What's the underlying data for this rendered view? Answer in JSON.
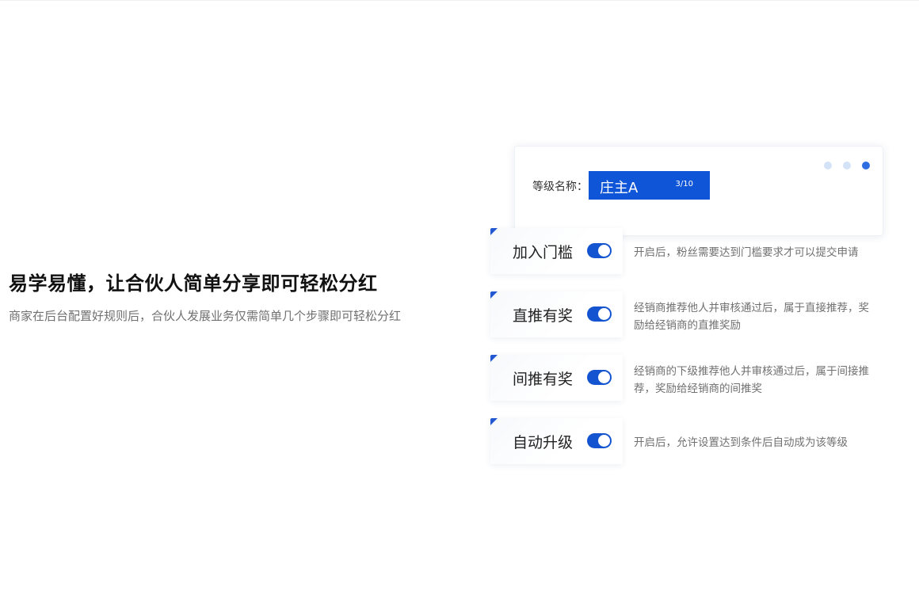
{
  "headline": "易学易懂，让合伙人简单分享即可轻松分红",
  "subline": "商家在后台配置好规则后，合伙人发展业务仅需简单几个步骤即可轻松分红",
  "level_card": {
    "label": "等级名称：",
    "input_value": "庄主A",
    "char_count": "3/10",
    "pager": {
      "total": 3,
      "active_index": 2,
      "active_color": "#2f6ee0",
      "inactive_color": "#d4e2f8"
    }
  },
  "features": [
    {
      "label": "加入门槛",
      "enabled": true,
      "description": "开启后，粉丝需要达到门槛要求才可以提交申请"
    },
    {
      "label": "直推有奖",
      "enabled": true,
      "description": "经销商推荐他人并审核通过后，属于直接推荐，奖励给经销商的直推奖励"
    },
    {
      "label": "间推有奖",
      "enabled": true,
      "description": "经销商的下级推荐他人并审核通过后，属于间接推荐，奖励给经销商的间推奖"
    },
    {
      "label": "自动升级",
      "enabled": true,
      "description": "开启后，允许设置达到条件后自动成为该等级"
    }
  ],
  "colors": {
    "accent": "#1454d0",
    "input_bg": "#0f55d8",
    "headline": "#111111",
    "muted_text": "#707070"
  }
}
